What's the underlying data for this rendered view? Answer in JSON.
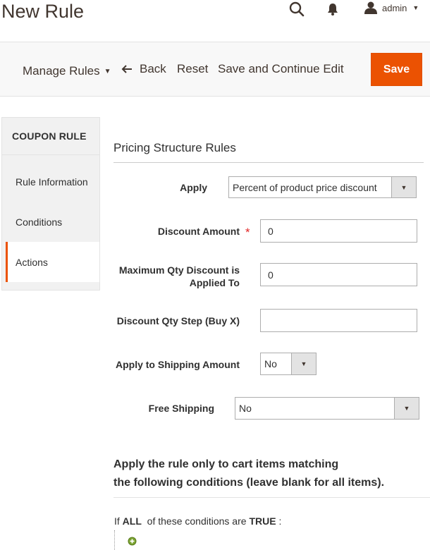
{
  "header": {
    "title": "New Rule",
    "user": "admin"
  },
  "toolbar": {
    "manage_rules": "Manage Rules",
    "back": "Back",
    "reset": "Reset",
    "save_and_continue": "Save and Continue Edit",
    "save": "Save"
  },
  "sidebar": {
    "title": "COUPON RULE",
    "items": [
      {
        "label": "Rule Information"
      },
      {
        "label": "Conditions"
      },
      {
        "label": "Actions"
      }
    ]
  },
  "main": {
    "section_title": "Pricing Structure Rules",
    "fields": {
      "apply": {
        "label": "Apply",
        "value": "Percent of product price discount"
      },
      "discount_amount": {
        "label": "Discount Amount",
        "required": "*",
        "value": "0"
      },
      "max_qty": {
        "label_line1": "Maximum Qty Discount is",
        "label_line2": "Applied To",
        "value": "0"
      },
      "qty_step": {
        "label": "Discount Qty Step (Buy X)",
        "value": ""
      },
      "apply_shipping": {
        "label": "Apply to Shipping Amount",
        "value": "No"
      },
      "free_shipping": {
        "label": "Free Shipping",
        "value": "No"
      }
    },
    "conditions": {
      "title_line1": "Apply the rule only to cart items matching",
      "title_line2": "the following conditions (leave blank for all items).",
      "if_prefix": "If",
      "aggregator": "ALL",
      "middle": "of these conditions are",
      "value": "TRUE",
      "suffix": ":"
    }
  },
  "colors": {
    "accent": "#eb5202",
    "add_icon": "#79a22e"
  }
}
